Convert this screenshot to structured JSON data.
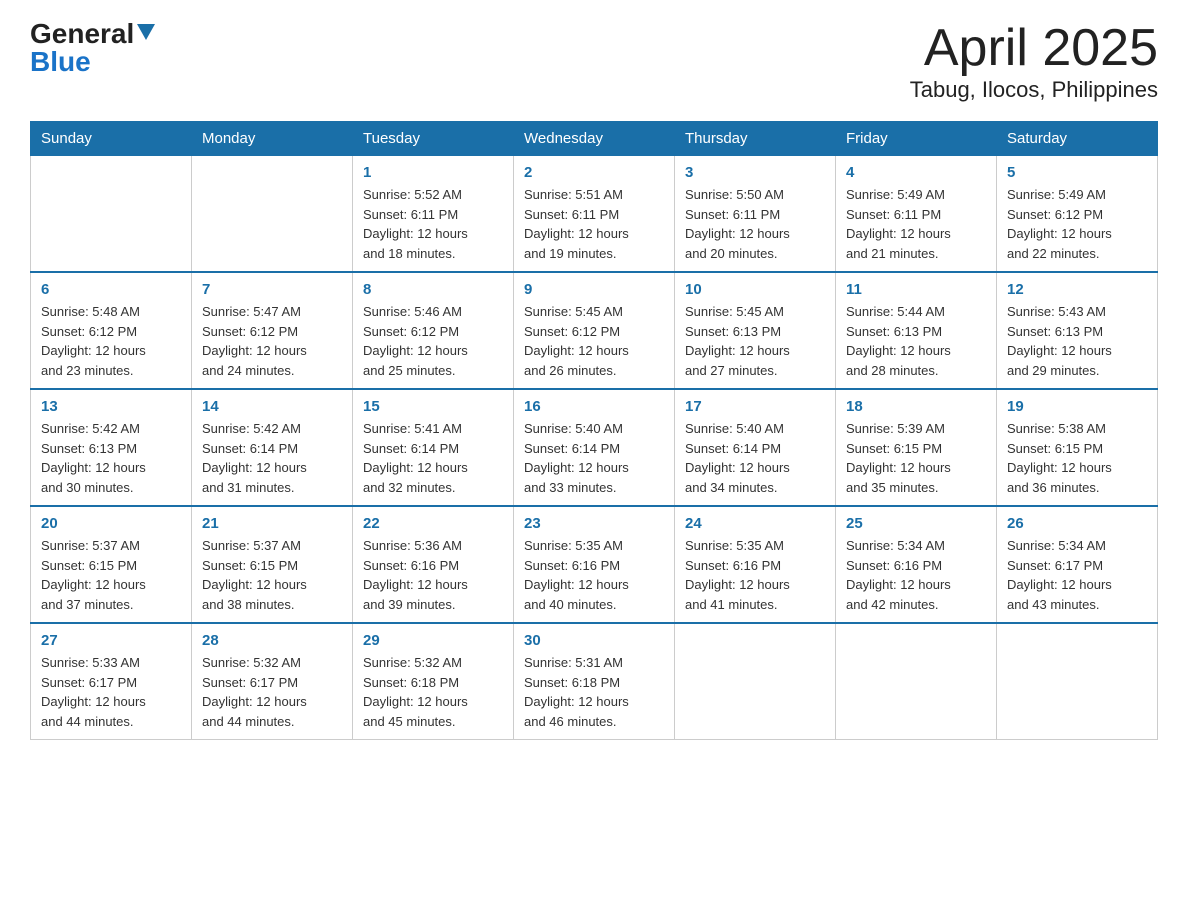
{
  "header": {
    "logo_general": "General",
    "logo_blue": "Blue",
    "month_title": "April 2025",
    "location": "Tabug, Ilocos, Philippines"
  },
  "weekdays": [
    "Sunday",
    "Monday",
    "Tuesday",
    "Wednesday",
    "Thursday",
    "Friday",
    "Saturday"
  ],
  "weeks": [
    [
      {
        "day": "",
        "info": ""
      },
      {
        "day": "",
        "info": ""
      },
      {
        "day": "1",
        "info": "Sunrise: 5:52 AM\nSunset: 6:11 PM\nDaylight: 12 hours\nand 18 minutes."
      },
      {
        "day": "2",
        "info": "Sunrise: 5:51 AM\nSunset: 6:11 PM\nDaylight: 12 hours\nand 19 minutes."
      },
      {
        "day": "3",
        "info": "Sunrise: 5:50 AM\nSunset: 6:11 PM\nDaylight: 12 hours\nand 20 minutes."
      },
      {
        "day": "4",
        "info": "Sunrise: 5:49 AM\nSunset: 6:11 PM\nDaylight: 12 hours\nand 21 minutes."
      },
      {
        "day": "5",
        "info": "Sunrise: 5:49 AM\nSunset: 6:12 PM\nDaylight: 12 hours\nand 22 minutes."
      }
    ],
    [
      {
        "day": "6",
        "info": "Sunrise: 5:48 AM\nSunset: 6:12 PM\nDaylight: 12 hours\nand 23 minutes."
      },
      {
        "day": "7",
        "info": "Sunrise: 5:47 AM\nSunset: 6:12 PM\nDaylight: 12 hours\nand 24 minutes."
      },
      {
        "day": "8",
        "info": "Sunrise: 5:46 AM\nSunset: 6:12 PM\nDaylight: 12 hours\nand 25 minutes."
      },
      {
        "day": "9",
        "info": "Sunrise: 5:45 AM\nSunset: 6:12 PM\nDaylight: 12 hours\nand 26 minutes."
      },
      {
        "day": "10",
        "info": "Sunrise: 5:45 AM\nSunset: 6:13 PM\nDaylight: 12 hours\nand 27 minutes."
      },
      {
        "day": "11",
        "info": "Sunrise: 5:44 AM\nSunset: 6:13 PM\nDaylight: 12 hours\nand 28 minutes."
      },
      {
        "day": "12",
        "info": "Sunrise: 5:43 AM\nSunset: 6:13 PM\nDaylight: 12 hours\nand 29 minutes."
      }
    ],
    [
      {
        "day": "13",
        "info": "Sunrise: 5:42 AM\nSunset: 6:13 PM\nDaylight: 12 hours\nand 30 minutes."
      },
      {
        "day": "14",
        "info": "Sunrise: 5:42 AM\nSunset: 6:14 PM\nDaylight: 12 hours\nand 31 minutes."
      },
      {
        "day": "15",
        "info": "Sunrise: 5:41 AM\nSunset: 6:14 PM\nDaylight: 12 hours\nand 32 minutes."
      },
      {
        "day": "16",
        "info": "Sunrise: 5:40 AM\nSunset: 6:14 PM\nDaylight: 12 hours\nand 33 minutes."
      },
      {
        "day": "17",
        "info": "Sunrise: 5:40 AM\nSunset: 6:14 PM\nDaylight: 12 hours\nand 34 minutes."
      },
      {
        "day": "18",
        "info": "Sunrise: 5:39 AM\nSunset: 6:15 PM\nDaylight: 12 hours\nand 35 minutes."
      },
      {
        "day": "19",
        "info": "Sunrise: 5:38 AM\nSunset: 6:15 PM\nDaylight: 12 hours\nand 36 minutes."
      }
    ],
    [
      {
        "day": "20",
        "info": "Sunrise: 5:37 AM\nSunset: 6:15 PM\nDaylight: 12 hours\nand 37 minutes."
      },
      {
        "day": "21",
        "info": "Sunrise: 5:37 AM\nSunset: 6:15 PM\nDaylight: 12 hours\nand 38 minutes."
      },
      {
        "day": "22",
        "info": "Sunrise: 5:36 AM\nSunset: 6:16 PM\nDaylight: 12 hours\nand 39 minutes."
      },
      {
        "day": "23",
        "info": "Sunrise: 5:35 AM\nSunset: 6:16 PM\nDaylight: 12 hours\nand 40 minutes."
      },
      {
        "day": "24",
        "info": "Sunrise: 5:35 AM\nSunset: 6:16 PM\nDaylight: 12 hours\nand 41 minutes."
      },
      {
        "day": "25",
        "info": "Sunrise: 5:34 AM\nSunset: 6:16 PM\nDaylight: 12 hours\nand 42 minutes."
      },
      {
        "day": "26",
        "info": "Sunrise: 5:34 AM\nSunset: 6:17 PM\nDaylight: 12 hours\nand 43 minutes."
      }
    ],
    [
      {
        "day": "27",
        "info": "Sunrise: 5:33 AM\nSunset: 6:17 PM\nDaylight: 12 hours\nand 44 minutes."
      },
      {
        "day": "28",
        "info": "Sunrise: 5:32 AM\nSunset: 6:17 PM\nDaylight: 12 hours\nand 44 minutes."
      },
      {
        "day": "29",
        "info": "Sunrise: 5:32 AM\nSunset: 6:18 PM\nDaylight: 12 hours\nand 45 minutes."
      },
      {
        "day": "30",
        "info": "Sunrise: 5:31 AM\nSunset: 6:18 PM\nDaylight: 12 hours\nand 46 minutes."
      },
      {
        "day": "",
        "info": ""
      },
      {
        "day": "",
        "info": ""
      },
      {
        "day": "",
        "info": ""
      }
    ]
  ]
}
